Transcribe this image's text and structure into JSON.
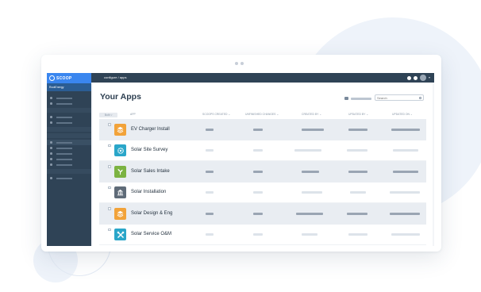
{
  "browser": {
    "indicator": "window-dots"
  },
  "sidebar": {
    "logo_text": "SCOOP",
    "workspace_label": "RootEnergy"
  },
  "topbar": {
    "breadcrumb": "configure / apps"
  },
  "main": {
    "title": "Your Apps",
    "search_placeholder": "Search",
    "columns": [
      {
        "key": "status",
        "label": "Both ▿"
      },
      {
        "key": "app",
        "label": "APP"
      },
      {
        "key": "scoops",
        "label": "SCOOPS CREATED ⌄"
      },
      {
        "key": "unfinished",
        "label": "UNFINISHED CHANGES ⌄"
      },
      {
        "key": "created_by",
        "label": "CREATED BY ⌄"
      },
      {
        "key": "updated_by",
        "label": "UPDATED BY ⌄"
      },
      {
        "key": "updated_on",
        "label": "UPDATED ON ⌄"
      }
    ],
    "apps": [
      {
        "name": "EV Charger Install",
        "icon": "layers-icon",
        "icon_color": "#f2a33a"
      },
      {
        "name": "Solar Site Survey",
        "icon": "gear-icon",
        "icon_color": "#2aa6c9"
      },
      {
        "name": "Solar Sales Intake",
        "icon": "plant-icon",
        "icon_color": "#7cb342"
      },
      {
        "name": "Solar Installation",
        "icon": "building-icon",
        "icon_color": "#5f6b78"
      },
      {
        "name": "Solar Design & Eng",
        "icon": "layers-icon",
        "icon_color": "#f2a33a"
      },
      {
        "name": "Solar Service O&M",
        "icon": "tools-icon",
        "icon_color": "#2aa6c9"
      }
    ]
  },
  "colors": {
    "sidebar_bg": "#2f4356",
    "brand_blue": "#3a86ef",
    "row_shade": "#e9edf2",
    "placeholder_dark": "#9aa5b3",
    "placeholder_light": "#dde3ea"
  }
}
